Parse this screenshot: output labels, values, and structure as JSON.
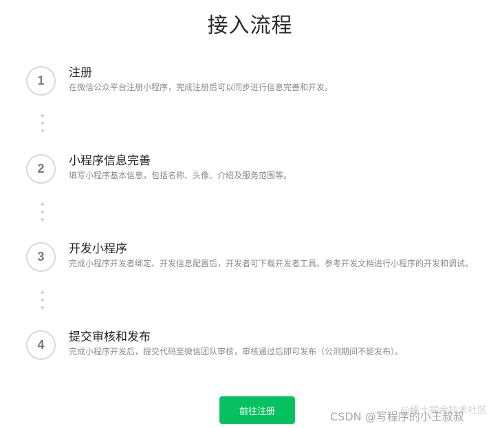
{
  "header": {
    "title": "接入流程"
  },
  "steps": [
    {
      "number": "1",
      "title": "注册",
      "desc": "在微信公众平台注册小程序，完成注册后可以同步进行信息完善和开发。"
    },
    {
      "number": "2",
      "title": "小程序信息完善",
      "desc": "填写小程序基本信息，包括名称、头像、介绍及服务范围等。"
    },
    {
      "number": "3",
      "title": "开发小程序",
      "desc": "完成小程序开发者绑定、开发信息配置后，开发者可下载开发者工具、参考开发文档进行小程序的开发和调试。"
    },
    {
      "number": "4",
      "title": "提交审核和发布",
      "desc": "完成小程序开发后，提交代码至微信团队审核，审核通过后即可发布（公测期间不能发布）。"
    }
  ],
  "cta": {
    "label": "前往注册",
    "color": "#07c160"
  },
  "watermarks": {
    "front": "CSDN @写程序的小王叔叔",
    "back": "@稀土掘金技术社区"
  }
}
